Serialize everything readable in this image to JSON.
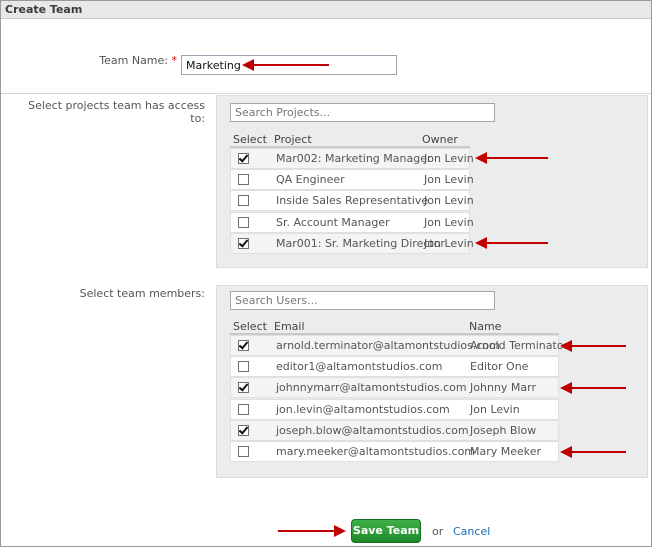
{
  "title": "Create Team",
  "team_name": {
    "label": "Team Name:",
    "required_mark": "*",
    "value": "Marketing"
  },
  "projects": {
    "label": "Select projects team has access to:",
    "search_placeholder": "Search Projects...",
    "columns": {
      "select": "Select",
      "project": "Project",
      "owner": "Owner"
    },
    "rows": [
      {
        "project": "Mar002: Marketing Manager",
        "owner": "Jon Levin",
        "checked": true
      },
      {
        "project": "QA Engineer",
        "owner": "Jon Levin",
        "checked": false
      },
      {
        "project": "Inside Sales Representative",
        "owner": "Jon Levin",
        "checked": false
      },
      {
        "project": "Sr. Account Manager",
        "owner": "Jon Levin",
        "checked": false
      },
      {
        "project": "Mar001: Sr. Marketing Director",
        "owner": "Jon Levin",
        "checked": true
      }
    ]
  },
  "members": {
    "label": "Select team members:",
    "search_placeholder": "Search Users...",
    "columns": {
      "select": "Select",
      "email": "Email",
      "name": "Name"
    },
    "rows": [
      {
        "email": "arnold.terminator@altamontstudios.com",
        "name": "Arnold Terminator",
        "checked": true
      },
      {
        "email": "editor1@altamontstudios.com",
        "name": "Editor One",
        "checked": false
      },
      {
        "email": "johnnymarr@altamontstudios.com",
        "name": "Johnny Marr",
        "checked": true
      },
      {
        "email": "jon.levin@altamontstudios.com",
        "name": "Jon Levin",
        "checked": false
      },
      {
        "email": "joseph.blow@altamontstudios.com",
        "name": "Joseph Blow",
        "checked": true
      },
      {
        "email": "mary.meeker@altamontstudios.com",
        "name": "Mary Meeker",
        "checked": false
      }
    ]
  },
  "actions": {
    "save_label": "Save Team",
    "or_text": "or",
    "cancel_label": "Cancel"
  },
  "colors": {
    "save_button": "#2a9a35",
    "arrow": "#c00000",
    "link": "#1f6fb5",
    "required": "#d40000"
  }
}
